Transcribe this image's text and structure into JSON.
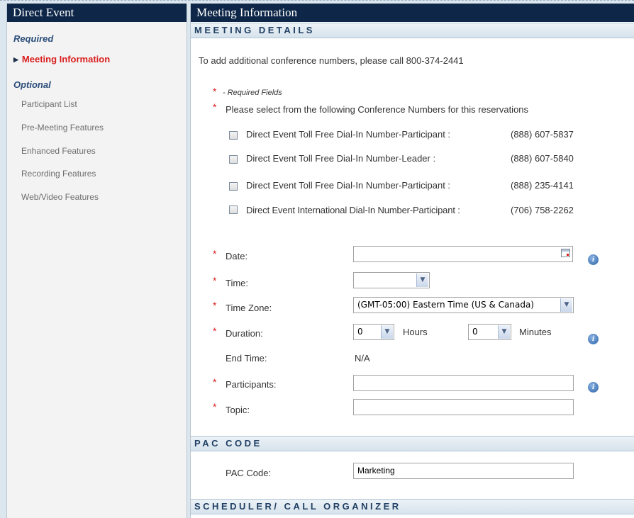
{
  "sidebar": {
    "title": "Direct Event",
    "required_heading": "Required",
    "active_item": "Meeting Information",
    "optional_heading": "Optional",
    "items": [
      "Participant List",
      "Pre-Meeting Features",
      "Enhanced Features",
      "Recording Features",
      "Web/Video Features"
    ]
  },
  "main": {
    "title": "Meeting Information",
    "section_meeting_details": "MEETING DETAILS",
    "intro": "To add additional conference numbers, please call 800-374-2441",
    "required_star": "*",
    "required_note": "- Required Fields",
    "select_prompt": "Please select from the following Conference Numbers for this reservations",
    "conference_numbers": [
      {
        "label": "Direct Event Toll Free Dial-In Number-Participant :",
        "number": "(888) 607-5837"
      },
      {
        "label": "Direct Event Toll Free Dial-In Number-Leader :",
        "number": "(888) 607-5840"
      },
      {
        "label": "Direct Event Toll Free Dial-In Number-Participant :",
        "number": "(888) 235-4141"
      },
      {
        "label": "Direct Event International Dial-In Number-Participant :",
        "number": "(706) 758-2262"
      }
    ],
    "form": {
      "date_label": "Date:",
      "date_value": "",
      "time_label": "Time:",
      "time_value": "",
      "timezone_label": "Time Zone:",
      "timezone_value": "(GMT-05:00) Eastern Time (US & Canada)",
      "duration_label": "Duration:",
      "hours_value": "0",
      "hours_label": "Hours",
      "minutes_value": "0",
      "minutes_label": "Minutes",
      "endtime_label": "End Time:",
      "endtime_value": "N/A",
      "participants_label": "Participants:",
      "participants_value": "",
      "topic_label": "Topic:",
      "topic_value": "",
      "info_glyph": "i"
    },
    "section_pac": "PAC CODE",
    "pac_label": "PAC Code:",
    "pac_value": "Marketing",
    "section_scheduler": "SCHEDULER/ CALL ORGANIZER"
  },
  "icons": {
    "active_marker": "triangle-right-icon",
    "dropdown": "chevron-down-icon",
    "calendar": "calendar-icon",
    "info": "info-icon"
  },
  "colors": {
    "header_bg": "#0e2748",
    "accent_red": "#d9201f",
    "section_text": "#203f63"
  }
}
